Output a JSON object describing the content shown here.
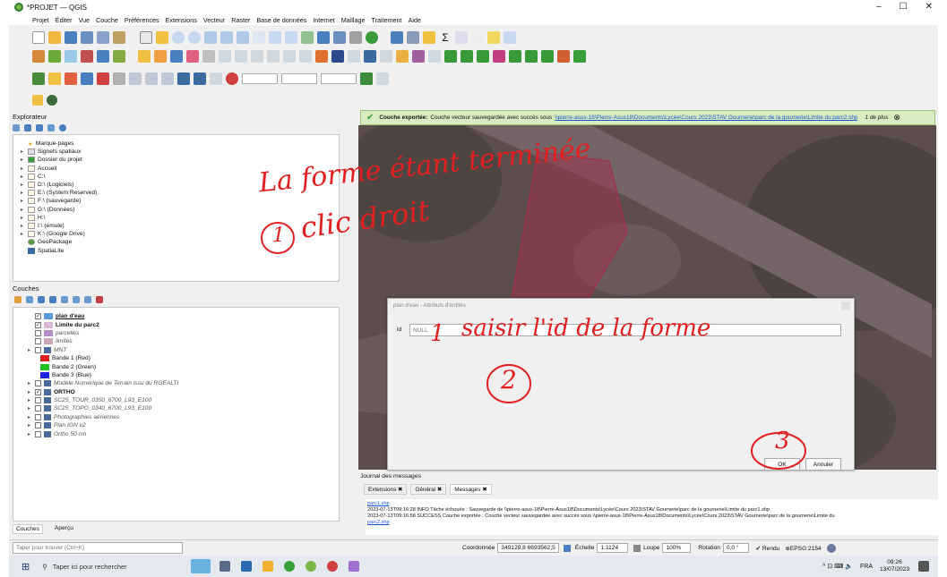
{
  "window": {
    "title": "*PROJET — QGIS",
    "min": "–",
    "max": "☐",
    "close": "✕"
  },
  "menu": [
    "Projet",
    "Éditer",
    "Vue",
    "Couche",
    "Préférences",
    "Extensions",
    "Vecteur",
    "Raster",
    "Base de données",
    "Internet",
    "Maillage",
    "Traitement",
    "Aide"
  ],
  "explorer": {
    "title": "Explorateur",
    "items": [
      "Marque-pages",
      "Signets spatiaux",
      "Dossier du projet",
      "Accueil",
      "C:\\",
      "D:\\ (Logiciels)",
      "E:\\ (System Reserved)",
      "F:\\ (sauvegarde)",
      "G:\\ (Données)",
      "H:\\",
      "I:\\ (emule)",
      "K:\\ (Google Drive)",
      "GeoPackage",
      "SpatiaLite"
    ]
  },
  "layers": {
    "title": "Couches",
    "items": [
      {
        "label": "plan d'eau",
        "checked": true,
        "color": "#5b9bd5",
        "style": "underline"
      },
      {
        "label": "Limite du parc2",
        "checked": true,
        "color": "#d8b8d8",
        "style": "bold"
      },
      {
        "label": "parcelles",
        "checked": false,
        "color": "#b38fc8",
        "style": "italic"
      },
      {
        "label": "limites",
        "checked": false,
        "color": "#c8a8b8",
        "style": "italic"
      },
      {
        "label": "MNT",
        "checked": false,
        "color": "",
        "style": "italic"
      },
      {
        "label": "Bande 1 (Red)",
        "checked": false,
        "color": "#e02020",
        "style": "sub"
      },
      {
        "label": "Bande 2 (Green)",
        "checked": false,
        "color": "#20c020",
        "style": "sub"
      },
      {
        "label": "Bande 3 (Blue)",
        "checked": false,
        "color": "#2020e0",
        "style": "sub"
      },
      {
        "label": "Modèle Numérique de Terrain issu du RGEALTI",
        "checked": false,
        "color": "",
        "style": "italic"
      },
      {
        "label": "ORTHO",
        "checked": true,
        "color": "",
        "style": "bold"
      },
      {
        "label": "SC25_TOUR_0350_6700_L93_E100",
        "checked": false,
        "color": "",
        "style": "italic"
      },
      {
        "label": "SC25_TOPO_0340_6700_L93_E100",
        "checked": false,
        "color": "",
        "style": "italic"
      },
      {
        "label": "Photographies aériennes",
        "checked": false,
        "color": "",
        "style": "italic"
      },
      {
        "label": "Plan IGN v2",
        "checked": false,
        "color": "",
        "style": "italic"
      },
      {
        "label": "Ortho 50 cm",
        "checked": false,
        "color": "",
        "style": "italic"
      }
    ],
    "tabs": [
      "Couches",
      "Aperçu"
    ],
    "search_placeholder": "Taper pour trouver (Ctrl+K)"
  },
  "notification": {
    "bold": "Couche exportée:",
    "text": "Couche vecteur sauvegardée avec succès sous",
    "link": "\\\\pierre-asus-18\\Pierre-Asus18\\Documents\\Lycée\\Cours 2023\\STAV Gournerie\\parc de la gournerie\\Limite du parc2.shp",
    "more": "1 de plus"
  },
  "dialog": {
    "title": "plan d'eau - Attributs d'entités",
    "field_label": "id",
    "field_value": "NULL",
    "ok": "OK",
    "cancel": "Annuler"
  },
  "journal": {
    "title": "Journal des messages",
    "tabs": [
      "Extensions",
      "Général",
      "Messages"
    ],
    "lines": [
      "parc1.shp",
      "2023-07-13T09:16:28    INFO    Tâche échouée : Sauvegarde de \\\\pierre-asus-18\\Pierre-Asus18\\Documents\\Lycée\\Cours 2023\\STAV Gournerie\\parc de la gournerie\\Limite du parc1.shp",
      "2023-07-13T09:16:58    SUCCESS    Couche exportée : Couche vecteur sauvegardée avec succès sous \\\\pierre-asus-18\\Pierre-Asus18\\Documents\\Lycée\\Cours 2023\\STAV Gournerie\\parc de la gournerie\\Limite du",
      "parc2.shp"
    ]
  },
  "status": {
    "coord_label": "Coordonnée",
    "coord_value": "349129,8 6693562,5",
    "scale_label": "Échelle",
    "scale_value": "1:1124",
    "magnifier_label": "Loupe",
    "magnifier_value": "100%",
    "rotation_label": "Rotation",
    "rotation_value": "0,0 °",
    "render": "Rendu",
    "crs": "EPSG:2154"
  },
  "taskbar": {
    "search_placeholder": "Taper ici pour rechercher",
    "lang": "FRA",
    "time": "09:26",
    "date": "13/07/2023"
  },
  "annotations": {
    "line1": "La forme étant terminée",
    "step1_num": "1",
    "step1": "clic droit",
    "step_input_num": "1",
    "step_input": "saisir l'id de la forme",
    "step2": "2",
    "step3": "3"
  },
  "colors": {
    "annotation": "#e02020",
    "notif_bg": "#d7ecc0",
    "accent": "#589632"
  }
}
